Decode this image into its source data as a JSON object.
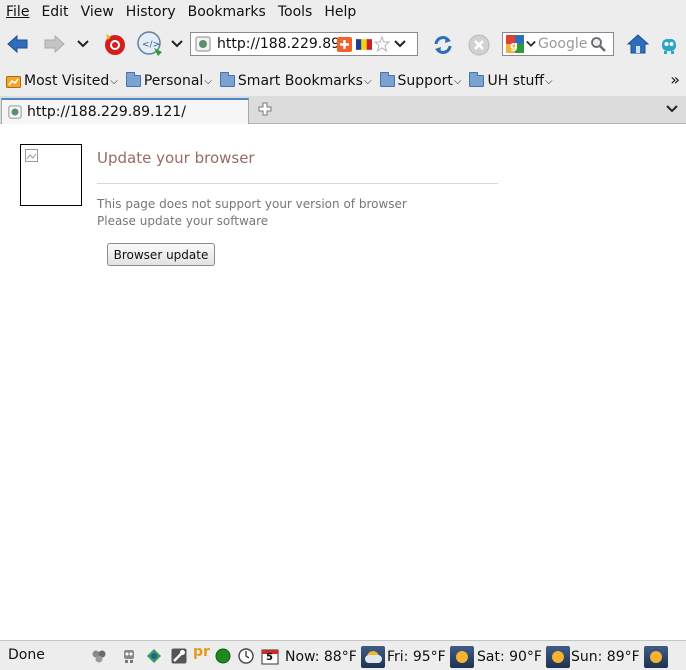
{
  "menubar": {
    "items": [
      "File",
      "Edit",
      "View",
      "History",
      "Bookmarks",
      "Tools",
      "Help"
    ]
  },
  "navbar": {
    "url": "http://188.229.89.121/",
    "search_placeholder": "Google"
  },
  "bookmarks": {
    "items": [
      "Most Visited",
      "Personal",
      "Smart Bookmarks",
      "Support",
      "UH stuff"
    ],
    "overflow": "»"
  },
  "tabs": {
    "active_label": "http://188.229.89.121/"
  },
  "page": {
    "title": "Update your browser",
    "message_line1": "This page does not support your version of browser",
    "message_line2": "Please update your software",
    "button_label": "Browser update"
  },
  "statusbar": {
    "status": "Done",
    "calendar_day": "5",
    "weather": [
      {
        "label": "Now: 88°F",
        "icon": "cloudy-sun-icon"
      },
      {
        "label": "Fri: 95°F",
        "icon": "sun-icon"
      },
      {
        "label": "Sat: 90°F",
        "icon": "sun-icon"
      },
      {
        "label": "Sun: 89°F",
        "icon": "sun-icon"
      }
    ]
  },
  "colors": {
    "title": "#9a6a66",
    "message": "#777777",
    "chrome": "#ededed",
    "back_arrow": "#2f6db8",
    "folder": "#7aa3d4"
  }
}
